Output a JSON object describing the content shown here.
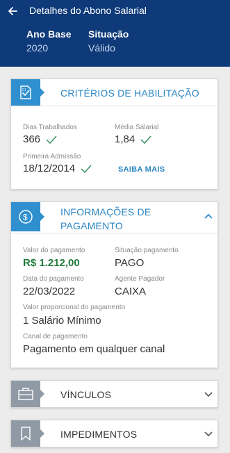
{
  "header": {
    "title": "Detalhes do Abono Salarial",
    "ano_base_label": "Ano Base",
    "ano_base_value": "2020",
    "situacao_label": "Situação",
    "situacao_value": "Válido"
  },
  "criterios": {
    "title": "CRITÉRIOS DE HABILITAÇÃO",
    "dias_label": "Dias Trabalhados",
    "dias_value": "366",
    "media_label": "Média Salarial",
    "media_value": "1,84",
    "admissao_label": "Primeira Admissão",
    "admissao_value": "18/12/2014",
    "saiba_mais": "SAIBA MAIS"
  },
  "pagamento": {
    "title_line1": "INFORMAÇÕES DE",
    "title_line2": "PAGAMENTO",
    "valor_label": "Valor do pagamento",
    "valor_value": "R$ 1.212,00",
    "situacao_label": "Situação pagamento",
    "situacao_value": "PAGO",
    "data_label": "Data do pagamento",
    "data_value": "22/03/2022",
    "agente_label": "Agente Pagador",
    "agente_value": "CAIXA",
    "proporcional_label": "Valor proporcional do pagamento",
    "proporcional_value": "1 Salário Mínimo",
    "canal_label": "Canal de pagamento",
    "canal_value": "Pagamento em qualquer canal"
  },
  "vinculos": {
    "title": "VÍNCULOS"
  },
  "impedimentos": {
    "title": "IMPEDIMENTOS"
  },
  "colors": {
    "header_bg": "#0e3a7a",
    "accent_blue": "#2f8fcf",
    "title_blue": "#2b86c4",
    "check_green": "#2e8b57",
    "value_green": "#1f7a3a",
    "gray_icon": "#8f9aa5"
  },
  "icons": {
    "back": "arrow-left-icon",
    "criterios": "certificate-check-icon",
    "pagamento": "dollar-coin-icon",
    "vinculos": "briefcase-icon",
    "impedimentos": "bookmark-icon",
    "expand": "chevron-down-icon",
    "collapse": "chevron-up-icon",
    "check": "check-icon"
  }
}
